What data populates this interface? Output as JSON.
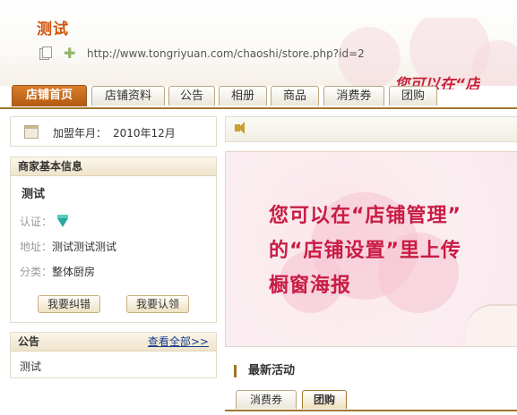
{
  "header": {
    "store_title": "测试",
    "url": "http://www.tongriyuan.com/chaoshi/store.php?id=2",
    "banner_strip": "您可以在“店"
  },
  "tabs": [
    {
      "label": "店铺首页",
      "active": true
    },
    {
      "label": "店铺资料",
      "active": false
    },
    {
      "label": "公告",
      "active": false
    },
    {
      "label": "相册",
      "active": false
    },
    {
      "label": "商品",
      "active": false
    },
    {
      "label": "消费券",
      "active": false
    },
    {
      "label": "团购",
      "active": false
    }
  ],
  "join": {
    "label": "加盟年月：",
    "value": "2010年12月"
  },
  "merchant_info": {
    "heading": "商家基本信息",
    "name": "测试",
    "certification_label": "认证：",
    "address_label": "地址：",
    "address_value": "测试测试测试",
    "category_label": "分类：",
    "category_value": "整体厨房",
    "correct_button": "我要纠错",
    "claim_button": "我要认领"
  },
  "notice": {
    "heading": "公告",
    "more_link": "查看全部>>",
    "body": "测试"
  },
  "poster": {
    "lines": [
      "您可以在“店铺管理”",
      "的“店铺设置”里上传",
      "橱窗海报"
    ]
  },
  "activities": {
    "heading": "最新活动",
    "tabs": [
      {
        "label": "消费券",
        "active": false
      },
      {
        "label": "团购",
        "active": true
      }
    ]
  },
  "colors": {
    "accent": "#b25a12",
    "title": "#d0530a",
    "poster_text": "#c81c45",
    "link": "#1a3c8c"
  }
}
